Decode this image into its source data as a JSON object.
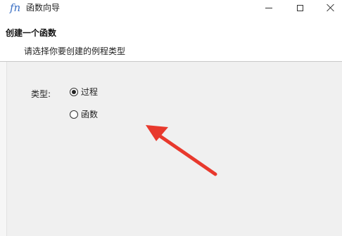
{
  "window": {
    "icon_glyph": "fn",
    "title": "函数向导",
    "controls": {
      "minimize": "minimize",
      "maximize": "maximize",
      "close": "close"
    }
  },
  "header": {
    "title": "创建一个函数",
    "subtitle": "请选择你要创建的例程类型"
  },
  "form": {
    "type_label": "类型:",
    "options": [
      {
        "label": "过程",
        "selected": true
      },
      {
        "label": "函数",
        "selected": false
      }
    ]
  },
  "annotation": {
    "arrow_color": "#e8392d"
  }
}
